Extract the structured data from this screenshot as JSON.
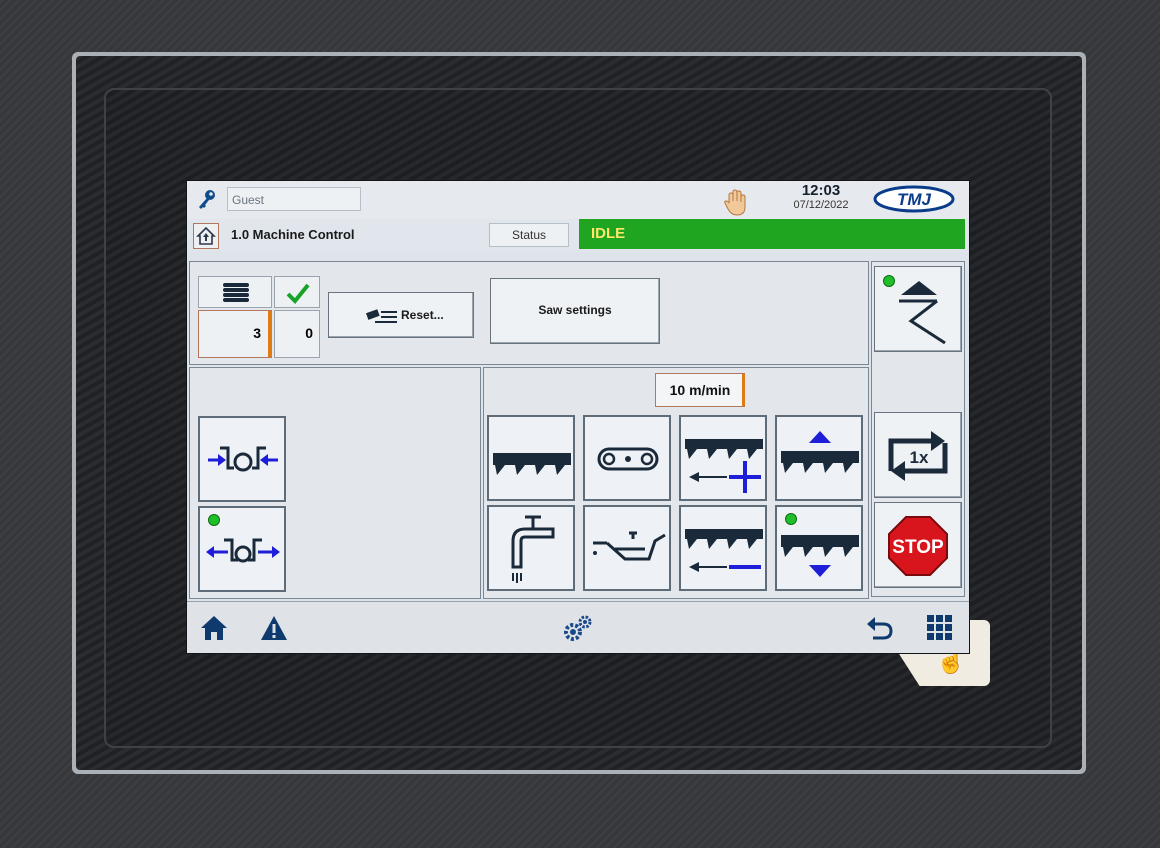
{
  "header": {
    "user": "Guest",
    "time": "12:03",
    "date": "07/12/2022",
    "logo_text": "TMJ"
  },
  "nav": {
    "title": "1.0 Machine Control",
    "status_label": "Status",
    "status_value": "IDLE"
  },
  "counters": {
    "count_total": "3",
    "count_done": "0"
  },
  "buttons": {
    "reset_label": "Reset...",
    "saw_settings_label": "Saw settings",
    "stop_label": "STOP",
    "cycle_label": "1x"
  },
  "speed": {
    "value": "10",
    "unit": "m/min"
  },
  "colors": {
    "status_bg": "#1fa51f",
    "status_text": "#ffe76a",
    "accent_blue": "#1e1ed9",
    "stop_red": "#d8141c",
    "indicator_green": "#1fbf2a"
  }
}
